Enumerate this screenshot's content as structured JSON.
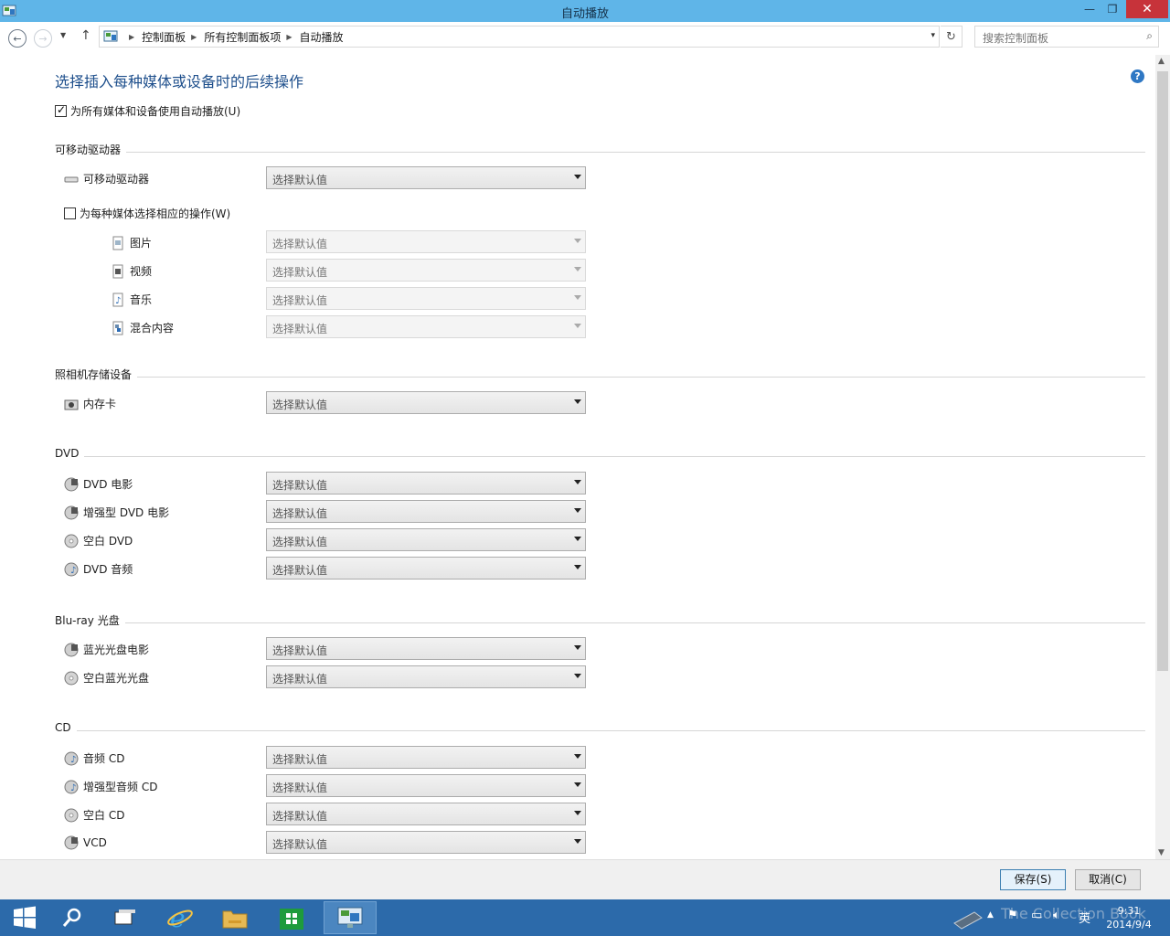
{
  "window": {
    "title": "自动播放"
  },
  "nav": {
    "breadcrumb": [
      "控制面板",
      "所有控制面板项",
      "自动播放"
    ],
    "search_placeholder": "搜索控制面板"
  },
  "main": {
    "heading": "选择插入每种媒体或设备时的后续操作",
    "use_autoplay_label": "为所有媒体和设备使用自动播放(U)",
    "use_autoplay_checked": true,
    "dropdown_default": "选择默认值",
    "removable": {
      "section": "可移动驱动器",
      "drive_label": "可移动驱动器",
      "per_media_label": "为每种媒体选择相应的操作(W)",
      "per_media_checked": false,
      "items": [
        {
          "label": "图片",
          "icon": "picture-file-icon"
        },
        {
          "label": "视频",
          "icon": "video-file-icon"
        },
        {
          "label": "音乐",
          "icon": "music-file-icon"
        },
        {
          "label": "混合内容",
          "icon": "mixed-content-icon"
        }
      ]
    },
    "camera": {
      "section": "照相机存储设备",
      "items": [
        {
          "label": "内存卡",
          "icon": "camera-icon"
        }
      ]
    },
    "dvd": {
      "section": "DVD",
      "items": [
        {
          "label": "DVD 电影",
          "icon": "dvd-movie-icon"
        },
        {
          "label": "增强型 DVD 电影",
          "icon": "dvd-movie-icon"
        },
        {
          "label": "空白 DVD",
          "icon": "blank-disc-icon"
        },
        {
          "label": "DVD 音频",
          "icon": "audio-disc-icon"
        }
      ]
    },
    "bluray": {
      "section": "Blu-ray 光盘",
      "items": [
        {
          "label": "蓝光光盘电影",
          "icon": "bluray-movie-icon"
        },
        {
          "label": "空白蓝光光盘",
          "icon": "blank-disc-icon"
        }
      ]
    },
    "cd": {
      "section": "CD",
      "items": [
        {
          "label": "音频 CD",
          "icon": "audio-disc-icon"
        },
        {
          "label": "增强型音频 CD",
          "icon": "audio-disc-icon"
        },
        {
          "label": "空白 CD",
          "icon": "blank-disc-icon"
        },
        {
          "label": "VCD",
          "icon": "vcd-icon"
        }
      ]
    }
  },
  "buttons": {
    "save": "保存(S)",
    "cancel": "取消(C)"
  },
  "taskbar": {
    "tray_ime": "英",
    "time": "9:31",
    "date": "2014/9/4",
    "watermark": "The Collection Book"
  }
}
